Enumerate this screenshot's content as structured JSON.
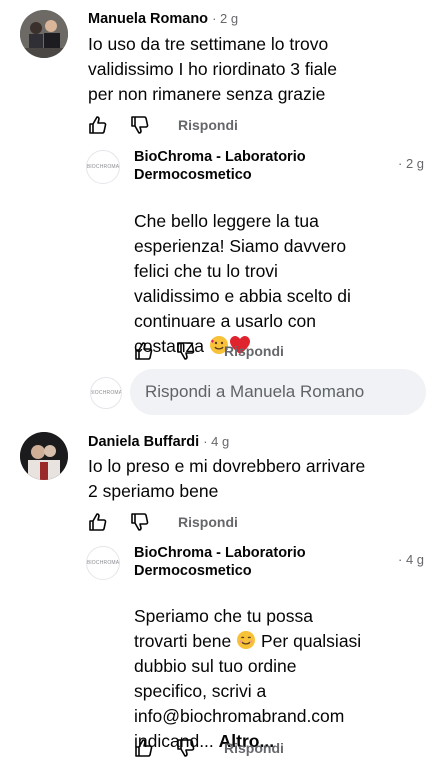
{
  "comments": [
    {
      "author": "Manuela Romano",
      "time": "· 2 g",
      "text": "Io uso da tre settimane lo trovo\nvalidissimo I ho riordinato 3 fiale\nper non rimanere senza grazie",
      "reply_label": "Rispondi",
      "reply": {
        "author": "BioChroma - Laboratorio\nDermocosmetico",
        "time": "· 2 g",
        "text_before_emoji": "Che bello leggere la tua\nesperienza! Siamo davvero\nfelici che tu lo trovi\nvalidissimo e abbia scelto di\ncontinuare a usarlo con\ncostanza ",
        "reply_label": "Rispondi"
      }
    },
    {
      "author": "Daniela Buffardi",
      "time": "· 4 g",
      "text": "Io lo preso e mi dovrebbero arrivare\n2 speriamo bene",
      "reply_label": "Rispondi",
      "reply": {
        "author": "BioChroma - Laboratorio\nDermocosmetico",
        "time": "· 4 g",
        "text_part1": "Speriamo che tu possa\ntrovarti bene ",
        "text_part2": " Per qualsiasi\ndubbio sul tuo ordine\nspecifico, scrivi a\ninfo@biochromabrand.com\nindicand... ",
        "more_label": "Altro...",
        "reply_label": "Rispondi"
      }
    }
  ],
  "reply_input": {
    "placeholder": "Rispondi a Manuela Romano"
  },
  "brand_mark": "BIOCHROMA",
  "icons": [
    "like-icon",
    "dislike-icon",
    "smiling-face-with-hearts-emoji",
    "red-heart-emoji",
    "smiling-face-emoji"
  ]
}
